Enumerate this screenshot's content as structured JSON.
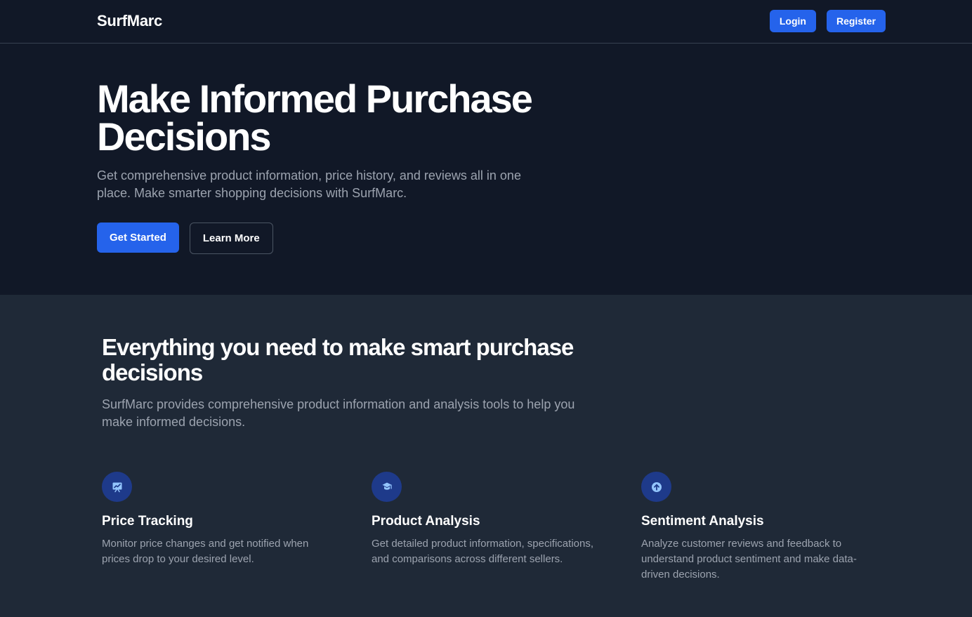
{
  "nav": {
    "brand": "SurfMarc",
    "login_label": "Login",
    "register_label": "Register"
  },
  "hero": {
    "title": "Make Informed Purchase Decisions",
    "subtitle": "Get comprehensive product information, price history, and reviews all in one place. Make smarter shopping decisions with SurfMarc.",
    "primary_cta": "Get Started",
    "secondary_cta": "Learn More"
  },
  "features": {
    "title": "Everything you need to make smart purchase decisions",
    "subtitle": "SurfMarc provides comprehensive product information and analysis tools to help you make informed decisions.",
    "items": [
      {
        "icon": "price-chart-icon",
        "title": "Price Tracking",
        "description": "Monitor price changes and get notified when prices drop to your desired level."
      },
      {
        "icon": "analysis-icon",
        "title": "Product Analysis",
        "description": "Get detailed product information, specifications, and comparisons across different sellers."
      },
      {
        "icon": "sentiment-icon",
        "title": "Sentiment Analysis",
        "description": "Analyze customer reviews and feedback to understand product sentiment and make data-driven decisions."
      }
    ]
  },
  "colors": {
    "accent": "#2563eb",
    "background": "#111827",
    "section_background": "#1f2937",
    "icon_background": "#1e3a8a",
    "icon_color": "#93c5fd"
  }
}
